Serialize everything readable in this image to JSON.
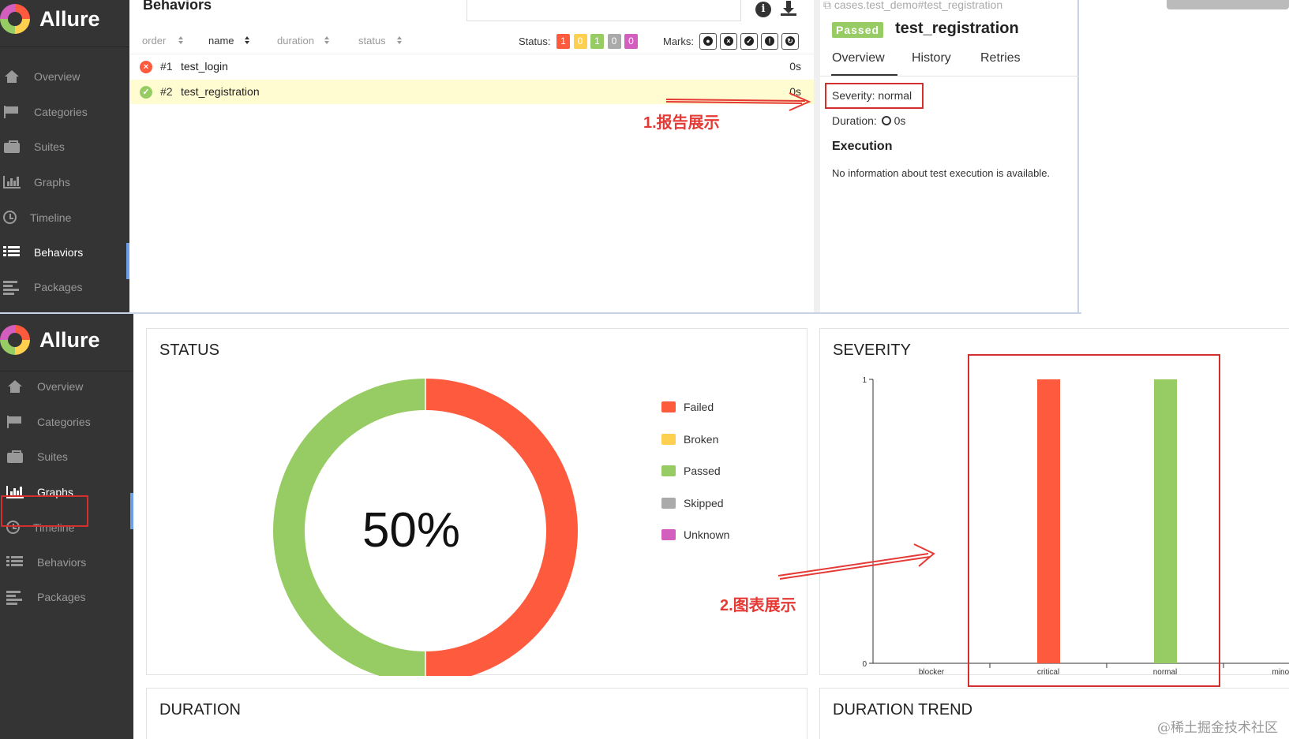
{
  "top_app": {
    "logo_text": "Allure",
    "nav": [
      {
        "label": "Overview",
        "icon": "home-icon"
      },
      {
        "label": "Categories",
        "icon": "flag-icon"
      },
      {
        "label": "Suites",
        "icon": "briefcase-icon"
      },
      {
        "label": "Graphs",
        "icon": "bar-chart-icon"
      },
      {
        "label": "Timeline",
        "icon": "clock-icon"
      },
      {
        "label": "Behaviors",
        "icon": "list-icon",
        "active": true
      },
      {
        "label": "Packages",
        "icon": "align-left-icon"
      }
    ],
    "page_title": "Behaviors",
    "columns": [
      "order",
      "name",
      "duration",
      "status"
    ],
    "status_label": "Status:",
    "status_badges": [
      {
        "value": "1",
        "color": "#fd5a3e"
      },
      {
        "value": "0",
        "color": "#ffd050"
      },
      {
        "value": "1",
        "color": "#97cc64"
      },
      {
        "value": "0",
        "color": "#aaaaaa"
      },
      {
        "value": "0",
        "color": "#d35ebe"
      }
    ],
    "marks_label": "Marks:",
    "marks": [
      "flaky-icon",
      "new-failed-icon",
      "new-passed-icon",
      "new-broken-icon",
      "retries-icon"
    ],
    "rows": [
      {
        "num": "#1",
        "name": "test_login",
        "duration": "0s",
        "status": "failed"
      },
      {
        "num": "#2",
        "name": "test_registration",
        "duration": "0s",
        "status": "passed"
      }
    ],
    "detail": {
      "breadcrumb": "cases.test_demo#test_registration",
      "status_badge": "Passed",
      "title": "test_registration",
      "tabs": [
        "Overview",
        "History",
        "Retries"
      ],
      "severity": "Severity: normal",
      "duration_label": "Duration:",
      "duration_value": "0s",
      "execution_heading": "Execution",
      "execution_text": "No information about test execution is available."
    },
    "annotation": "1.报告展示"
  },
  "bottom_app": {
    "logo_text": "Allure",
    "nav": [
      {
        "label": "Overview",
        "icon": "home-icon"
      },
      {
        "label": "Categories",
        "icon": "flag-icon"
      },
      {
        "label": "Suites",
        "icon": "briefcase-icon"
      },
      {
        "label": "Graphs",
        "icon": "bar-chart-icon",
        "active": true
      },
      {
        "label": "Timeline",
        "icon": "clock-icon"
      },
      {
        "label": "Behaviors",
        "icon": "list-icon"
      },
      {
        "label": "Packages",
        "icon": "align-left-icon"
      }
    ],
    "status_card": {
      "title": "STATUS",
      "center_text": "50%",
      "legend": [
        {
          "label": "Failed",
          "color": "#fd5a3e"
        },
        {
          "label": "Broken",
          "color": "#ffd050"
        },
        {
          "label": "Passed",
          "color": "#97cc64"
        },
        {
          "label": "Skipped",
          "color": "#aaaaaa"
        },
        {
          "label": "Unknown",
          "color": "#d35ebe"
        }
      ]
    },
    "severity_card": {
      "title": "SEVERITY"
    },
    "duration_card": {
      "title": "DURATION"
    },
    "duration_trend_card": {
      "title": "DURATION TREND"
    },
    "annotation": "2.图表展示",
    "watermark": "@稀土掘金技术社区"
  },
  "chart_data": [
    {
      "type": "pie",
      "title": "STATUS",
      "categories": [
        "Failed",
        "Broken",
        "Passed",
        "Skipped",
        "Unknown"
      ],
      "values": [
        1,
        0,
        1,
        0,
        0
      ],
      "colors": [
        "#fd5a3e",
        "#ffd050",
        "#97cc64",
        "#aaaaaa",
        "#d35ebe"
      ]
    },
    {
      "type": "bar",
      "title": "SEVERITY",
      "categories": [
        "blocker",
        "critical",
        "normal",
        "minor"
      ],
      "series": [
        {
          "values": [
            0,
            1,
            0,
            0
          ],
          "color": "#fd5a3e"
        },
        {
          "values": [
            0,
            0,
            1,
            0
          ],
          "color": "#97cc64"
        }
      ],
      "yticks": [
        "0",
        "1"
      ],
      "ylim": [
        0,
        1
      ]
    }
  ]
}
